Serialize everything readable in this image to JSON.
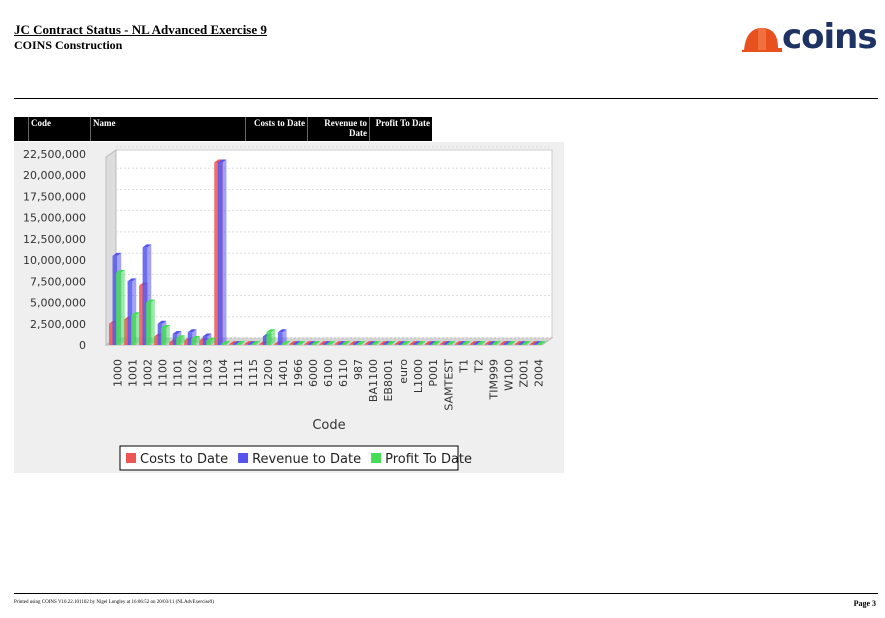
{
  "report": {
    "title": "JC Contract Status - NL Advanced Exercise 9",
    "company": "COINS Construction",
    "logo_text": "coins"
  },
  "table_header": {
    "code": "Code",
    "name": "Name",
    "costs": "Costs to Date",
    "revenue": "Revenue to Date",
    "profit": "Profit To Date"
  },
  "chart_data": {
    "type": "bar",
    "xlabel": "Code",
    "ylabel": "",
    "ylim": [
      0,
      22500000
    ],
    "yticks": [
      "0",
      "2,500,000",
      "5,000,000",
      "7,500,000",
      "10,000,000",
      "12,500,000",
      "15,000,000",
      "17,500,000",
      "20,000,000",
      "22,500,000"
    ],
    "categories": [
      "1000",
      "1001",
      "1002",
      "1100",
      "1101",
      "1102",
      "1103",
      "1104",
      "1111",
      "1115",
      "1200",
      "1401",
      "1966",
      "6000",
      "6100",
      "6110",
      "987",
      "BA1100",
      "EB8001",
      "euro",
      "L1000",
      "P001",
      "SAMTEST",
      "T1",
      "T2",
      "TIM999",
      "W100",
      "Z001",
      "2004"
    ],
    "series": [
      {
        "name": "Costs to Date",
        "color": "#ee5555",
        "values": [
          2500000,
          3000000,
          7000000,
          1000000,
          300000,
          500000,
          500000,
          21500000,
          0,
          0,
          0,
          0,
          0,
          0,
          0,
          0,
          0,
          0,
          0,
          0,
          0,
          0,
          0,
          0,
          0,
          0,
          0,
          0,
          0
        ]
      },
      {
        "name": "Revenue to Date",
        "color": "#5555ee",
        "values": [
          10500000,
          7500000,
          11500000,
          2500000,
          1300000,
          1500000,
          1000000,
          21500000,
          0,
          0,
          1000000,
          1500000,
          0,
          0,
          0,
          0,
          0,
          0,
          0,
          0,
          0,
          0,
          0,
          0,
          0,
          0,
          0,
          0,
          0
        ]
      },
      {
        "name": "Profit To Date",
        "color": "#44dd55",
        "values": [
          8500000,
          3500000,
          5000000,
          2000000,
          800000,
          700000,
          500000,
          -500000,
          0,
          0,
          1500000,
          100000,
          0,
          0,
          0,
          0,
          0,
          0,
          0,
          0,
          0,
          0,
          0,
          0,
          0,
          0,
          0,
          0,
          0
        ]
      }
    ],
    "legend_position": "bottom",
    "grid": true
  },
  "footer": {
    "printed": "Printed using COINS V10.22.101102 by Nigel Longley at 16:06:52 on 20/03/11 (NLAdvExercise9)",
    "page": "Page 3"
  }
}
